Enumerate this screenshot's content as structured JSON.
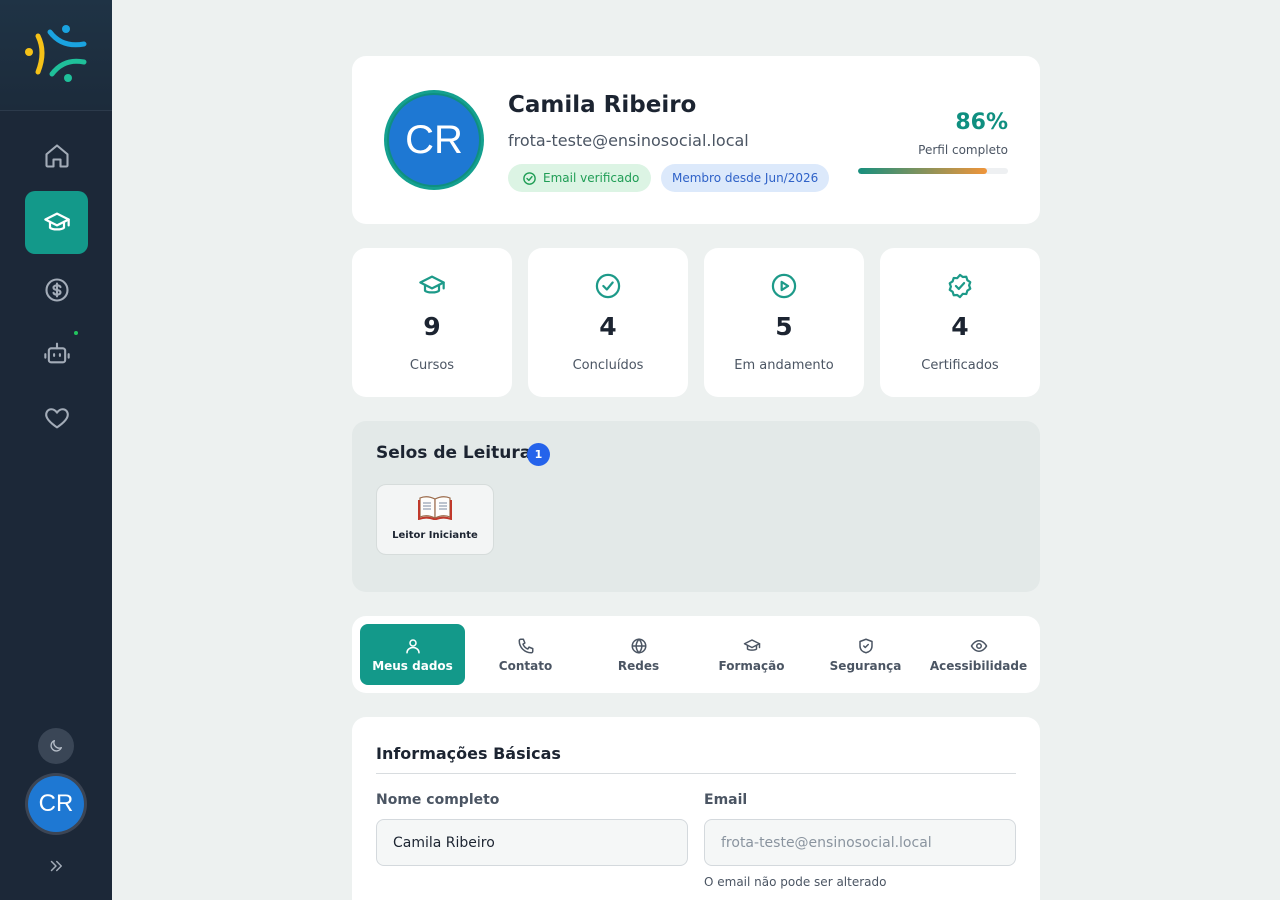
{
  "sidebar": {
    "nav": [
      "home-icon",
      "graduation-cap-icon",
      "dollar-circle-icon",
      "robot-icon",
      "heart-icon"
    ],
    "active_index": 1,
    "avatar_initials": "CR"
  },
  "profile": {
    "initials": "CR",
    "name": "Camila Ribeiro",
    "email": "frota-teste@ensinosocial.local",
    "badge_verified": "Email verificado",
    "badge_member": "Membro desde Jun/2026",
    "completion_pct": "86%",
    "completion_value": 0.86,
    "completion_label": "Perfil completo"
  },
  "stats": [
    {
      "icon": "graduation-cap-icon",
      "value": "9",
      "label": "Cursos"
    },
    {
      "icon": "check-circle-icon",
      "value": "4",
      "label": "Concluídos"
    },
    {
      "icon": "play-circle-icon",
      "value": "5",
      "label": "Em andamento"
    },
    {
      "icon": "badge-check-icon",
      "value": "4",
      "label": "Certificados"
    }
  ],
  "seals": {
    "title": "Selos de Leitura",
    "count": "1",
    "items": [
      {
        "icon": "open-book-icon",
        "label": "Leitor Iniciante"
      }
    ]
  },
  "tabs": [
    {
      "icon": "user-icon",
      "label": "Meus dados"
    },
    {
      "icon": "phone-icon",
      "label": "Contato"
    },
    {
      "icon": "globe-icon",
      "label": "Redes"
    },
    {
      "icon": "graduation-cap-icon",
      "label": "Formação"
    },
    {
      "icon": "shield-check-icon",
      "label": "Segurança"
    },
    {
      "icon": "eye-icon",
      "label": "Acessibilidade"
    }
  ],
  "form": {
    "title": "Informações Básicas",
    "name_label": "Nome completo",
    "name_value": "Camila Ribeiro",
    "email_label": "Email",
    "email_value": "frota-teste@ensinosocial.local",
    "email_help": "O email não pode ser alterado"
  },
  "colors": {
    "accent": "#13998a",
    "sidebar": "#1c2838",
    "avatar": "#1e78d3"
  }
}
